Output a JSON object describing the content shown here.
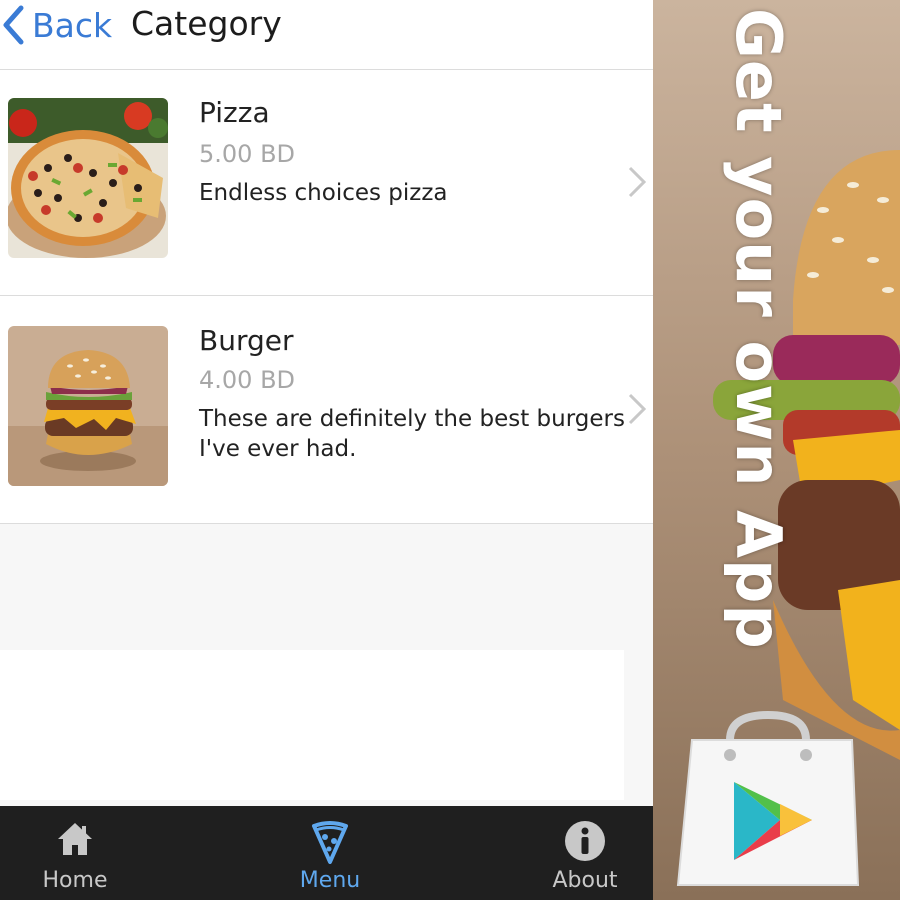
{
  "header": {
    "back_label": "Back",
    "title": "Category"
  },
  "items": [
    {
      "name": "Pizza",
      "price": "5.00 BD",
      "description": "Endless choices pizza",
      "image_icon": "pizza-photo"
    },
    {
      "name": "Burger",
      "price": "4.00 BD",
      "description": "These are definitely the best burgers I've ever had.",
      "image_icon": "burger-photo"
    }
  ],
  "tabbar": {
    "tabs": [
      {
        "label": "Home",
        "icon": "home-icon",
        "active": false
      },
      {
        "label": "Menu",
        "icon": "pizza-slice-icon",
        "active": true
      },
      {
        "label": "About",
        "icon": "info-icon",
        "active": false
      }
    ]
  },
  "ad": {
    "text": "Get your own App",
    "icon": "google-play-bag-icon"
  },
  "colors": {
    "accent": "#3a7bd5",
    "active_tab": "#5fa8ee",
    "tabbar_bg": "#1f1f1f",
    "price_gray": "#a7a7a7"
  }
}
